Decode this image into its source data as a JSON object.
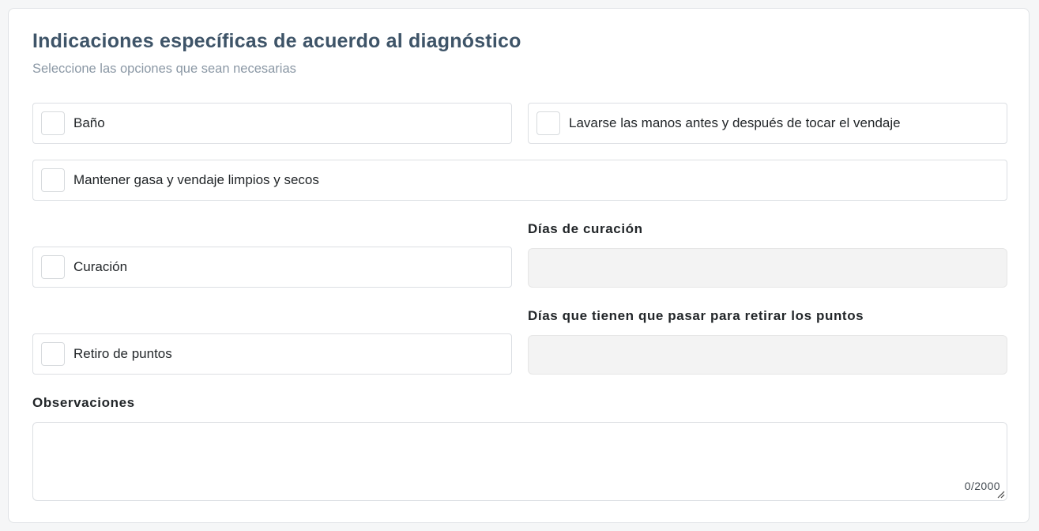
{
  "section": {
    "title": "Indicaciones específicas de acuerdo al diagnóstico",
    "subtitle": "Seleccione las opciones que sean necesarias"
  },
  "checkboxes": {
    "bano": {
      "label": "Baño",
      "checked": false
    },
    "lavarse_manos": {
      "label": "Lavarse las manos antes y después de tocar el vendaje",
      "checked": false
    },
    "mantener_gasa": {
      "label": "Mantener gasa y vendaje limpios y secos",
      "checked": false
    },
    "curacion": {
      "label": "Curación",
      "checked": false
    },
    "retiro_puntos": {
      "label": "Retiro de puntos",
      "checked": false
    }
  },
  "fields": {
    "dias_curacion": {
      "label": "Días de curación",
      "value": "",
      "disabled": true
    },
    "dias_retiro": {
      "label": "Días que tienen que pasar para retirar los puntos",
      "value": "",
      "disabled": true
    },
    "observaciones": {
      "label": "Observaciones",
      "value": "",
      "counter": "0/2000"
    }
  },
  "icons": {
    "resize_handle": "resize-grip-icon"
  }
}
